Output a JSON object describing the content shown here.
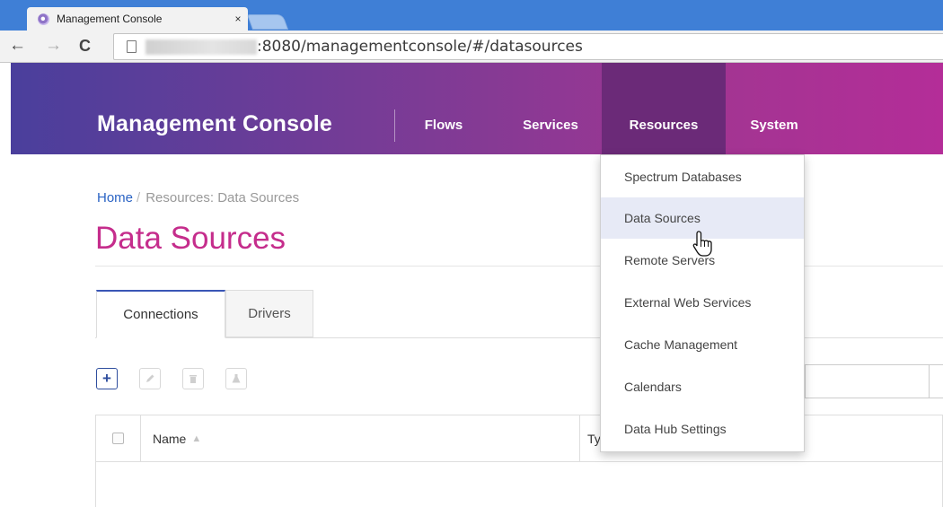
{
  "browser": {
    "tab_title": "Management Console",
    "tab_close": "×",
    "url": ":8080/managementconsole/#/datasources",
    "icons": {
      "back": "arrow-left-icon",
      "forward": "arrow-right-icon",
      "reload": "reload-icon",
      "page": "page-icon"
    }
  },
  "navbar": {
    "brand": "Management Console",
    "items": [
      {
        "label": "Flows"
      },
      {
        "label": "Services"
      },
      {
        "label": "Resources"
      },
      {
        "label": "System"
      }
    ],
    "active_item": "Resources",
    "gradient_colors": [
      "#4a3f9c",
      "#7e3b95",
      "#a23592",
      "#b42d98"
    ],
    "active_color": "#6b2a78"
  },
  "breadcrumb": {
    "home": "Home",
    "separator": "/",
    "current": "Resources: Data Sources"
  },
  "page": {
    "title": "Data Sources",
    "title_color": "#c52d8c"
  },
  "tabs": [
    {
      "label": "Connections",
      "active": true
    },
    {
      "label": "Drivers",
      "active": false
    }
  ],
  "toolbar": {
    "add_label": "+",
    "buttons": [
      "add-icon",
      "pencil-icon",
      "trash-icon",
      "flask-icon"
    ]
  },
  "grid": {
    "columns": [
      {
        "label": "Name",
        "sortable": true
      },
      {
        "label": "Ty"
      }
    ]
  },
  "dropdown": {
    "items": [
      {
        "label": "Spectrum Databases"
      },
      {
        "label": "Data Sources"
      },
      {
        "label": "Remote Servers"
      },
      {
        "label": "External Web Services"
      },
      {
        "label": "Cache Management"
      },
      {
        "label": "Calendars"
      },
      {
        "label": "Data Hub Settings"
      }
    ],
    "active_item": "Data Sources"
  }
}
